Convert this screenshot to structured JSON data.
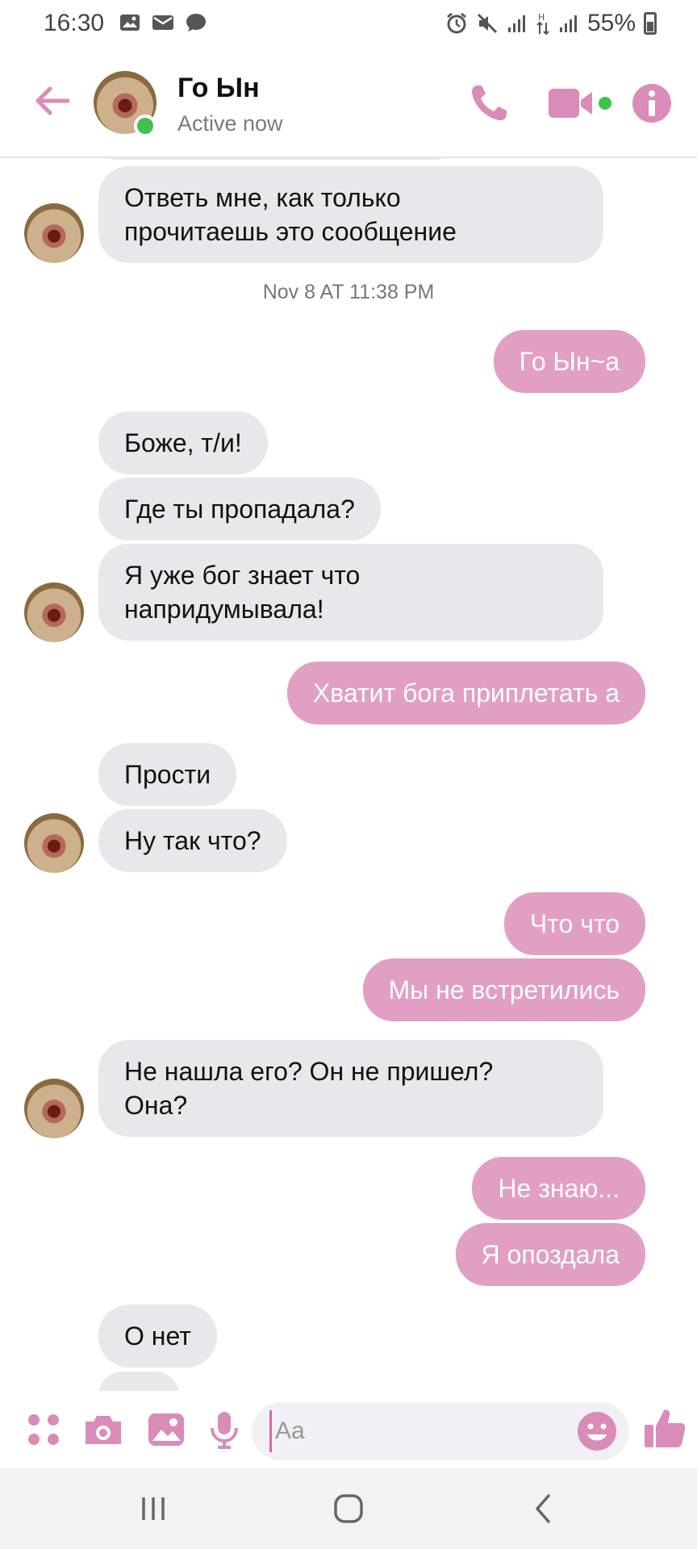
{
  "status_bar": {
    "time": "16:30",
    "battery": "55%",
    "left_icons": [
      "image-icon",
      "mail-icon",
      "chat-icon"
    ],
    "right_icons": [
      "alarm-icon",
      "mute-icon",
      "signal-icon",
      "data-icon",
      "signal-icon"
    ]
  },
  "header": {
    "contact_name": "Го Ын",
    "status": "Active now",
    "accent": "#d98cb8"
  },
  "messages": [
    {
      "dir": "in",
      "text_lines": [
        "Ответь мне, как только",
        "прочитаешь это сообщение"
      ]
    },
    {
      "type": "timestamp",
      "text": "Nov 8 AT 11:38 PM"
    },
    {
      "dir": "out",
      "text": "Го Ын~а"
    },
    {
      "dir": "in",
      "text": "Боже, т/и!"
    },
    {
      "dir": "in",
      "text": "Где ты пропадала?"
    },
    {
      "dir": "in",
      "text_lines": [
        "Я уже бог знает что",
        "напридумывала!"
      ]
    },
    {
      "dir": "out",
      "text": "Хватит бога приплетать а"
    },
    {
      "dir": "in",
      "text": "Прости"
    },
    {
      "dir": "in",
      "text": "Ну так что?"
    },
    {
      "dir": "out",
      "text": "Что что"
    },
    {
      "dir": "out",
      "text": "Мы не встретились"
    },
    {
      "dir": "in",
      "text_lines": [
        "Не нашла его? Он не пришел?",
        "Она?"
      ]
    },
    {
      "dir": "out",
      "text": "Не знаю..."
    },
    {
      "dir": "out",
      "text": "Я опоздала"
    },
    {
      "dir": "in",
      "text": "О нет"
    }
  ],
  "composer": {
    "placeholder": "Aa",
    "value": ""
  },
  "colors": {
    "outgoing_bubble": "#e19fc3",
    "incoming_bubble": "#e8e7eb",
    "online": "#3ec24b"
  }
}
